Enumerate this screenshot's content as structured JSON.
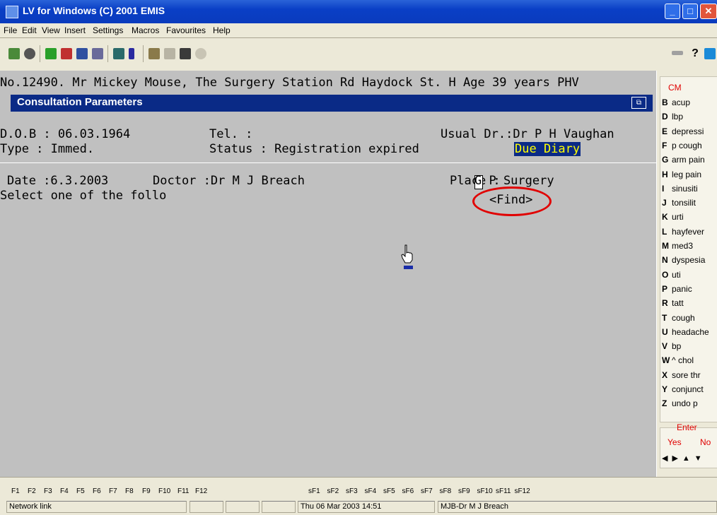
{
  "window": {
    "title": "LV for Windows (C) 2001 EMIS"
  },
  "menu": [
    "File",
    "Edit",
    "View",
    "Insert",
    "Settings",
    "Macros",
    "Favourites",
    "Help"
  ],
  "patient_line": "No.12490. Mr Mickey Mouse, The Surgery Station Rd Haydock St. H Age 39 years PHV",
  "panel_title": "Consultation Parameters",
  "fields": {
    "dob": "D.O.B : 06.03.1964",
    "tel": "Tel.  :",
    "usual_dr": "Usual Dr.:Dr P H Vaughan",
    "type": "Type  : Immed.",
    "status": "Status : Registration expired",
    "due_diary": "Due Diary",
    "date": "Date :6.3.2003",
    "doctor": "Doctor :Dr M J Breach",
    "place_label": "Place :",
    "place_value": "G P Surgery",
    "prompt": "Select one of the follo",
    "find": "<Find>"
  },
  "right_panel": {
    "header": "CM",
    "items": [
      {
        "key": "B",
        "label": "acup"
      },
      {
        "key": "D",
        "label": "lbp"
      },
      {
        "key": "E",
        "label": "depressi"
      },
      {
        "key": "F",
        "label": "p cough"
      },
      {
        "key": "G",
        "label": "arm pain"
      },
      {
        "key": "H",
        "label": "leg pain"
      },
      {
        "key": "I",
        "label": "sinusiti"
      },
      {
        "key": "J",
        "label": "tonsilit"
      },
      {
        "key": "K",
        "label": "urti"
      },
      {
        "key": "L",
        "label": "hayfever"
      },
      {
        "key": "M",
        "label": "med3"
      },
      {
        "key": "N",
        "label": "dyspesia"
      },
      {
        "key": "O",
        "label": "uti"
      },
      {
        "key": "P",
        "label": "panic"
      },
      {
        "key": "R",
        "label": "tatt"
      },
      {
        "key": "T",
        "label": "cough"
      },
      {
        "key": "U",
        "label": "headache"
      },
      {
        "key": "V",
        "label": "bp"
      },
      {
        "key": "W",
        "label": "^ chol"
      },
      {
        "key": "X",
        "label": "sore thr"
      },
      {
        "key": "Y",
        "label": "conjunct"
      },
      {
        "key": "Z",
        "label": "undo p"
      }
    ],
    "enter": "Enter",
    "yes": "Yes",
    "no": "No"
  },
  "fkeys": [
    "F1",
    "F2",
    "F3",
    "F4",
    "F5",
    "F6",
    "F7",
    "F8",
    "F9",
    "F10",
    "F11",
    "F12"
  ],
  "sfkeys": [
    "sF1",
    "sF2",
    "sF3",
    "sF4",
    "sF5",
    "sF6",
    "sF7",
    "sF8",
    "sF9",
    "sF10",
    "sF11",
    "sF12"
  ],
  "status": {
    "network": "Network link",
    "datetime": "Thu 06 Mar 2003 14:51",
    "user": "MJB-Dr M J Breach"
  },
  "colors": {
    "accent": "#0a2a86",
    "highlight": "#ffff00",
    "annotation": "#e10000"
  }
}
